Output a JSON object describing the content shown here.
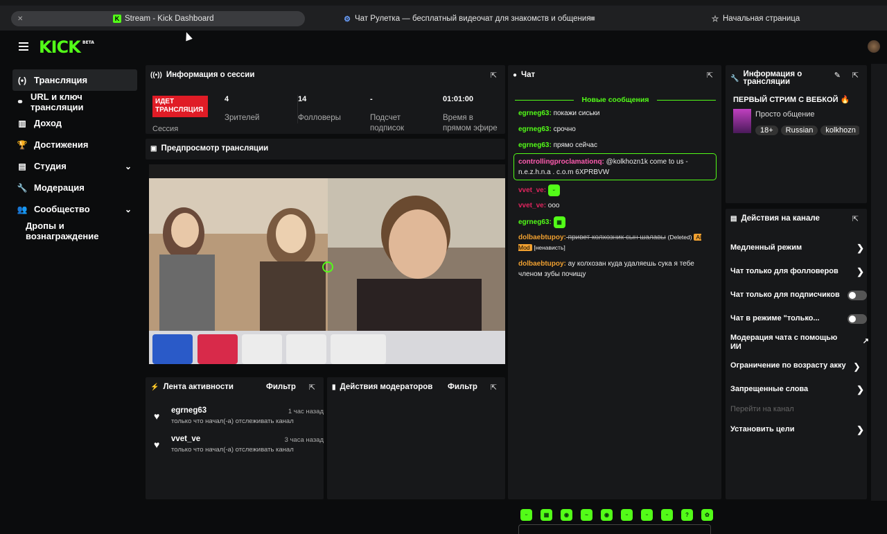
{
  "browser": {
    "tabs": [
      {
        "title": "Stream - Kick Dashboard",
        "active": true
      },
      {
        "title": "Чат Рулетка — бесплатный видеочат для знакомств и общения",
        "active": false
      },
      {
        "title": "Начальная страница",
        "active": false
      }
    ]
  },
  "header": {
    "logo": "KICK",
    "logo_badge": "BETA"
  },
  "sidebar": {
    "items": [
      {
        "label": "Трансляция",
        "icon": "broadcast-icon",
        "glyph": "(•)"
      },
      {
        "label": "URL и ключ трансляции",
        "icon": "link-icon",
        "glyph": "⚭"
      },
      {
        "label": "Доход",
        "icon": "chart-icon",
        "glyph": "▥"
      },
      {
        "label": "Достижения",
        "icon": "trophy-icon",
        "glyph": "🏆"
      },
      {
        "label": "Студия",
        "icon": "studio-icon",
        "glyph": "▤"
      },
      {
        "label": "Модерация",
        "icon": "wrench-icon",
        "glyph": "🔧"
      },
      {
        "label": "Сообщество",
        "icon": "community-icon",
        "glyph": "👥"
      },
      {
        "label": "Дропы и вознаграждение",
        "icon": "",
        "glyph": ""
      }
    ]
  },
  "session": {
    "title": "Информация о сессии",
    "badge": "ИДЕТ ТРАНСЛЯЦИЯ",
    "badge_label": "Сессия",
    "stats": [
      {
        "value": "4",
        "label": "Зрителей"
      },
      {
        "value": "14",
        "label": "Фолловеры"
      },
      {
        "value": "-",
        "label": "Подсчет подписок"
      },
      {
        "value": "01:01:00",
        "label": "Время в прямом эфире"
      }
    ]
  },
  "preview": {
    "title": "Предпросмотр трансляции"
  },
  "activity": {
    "title": "Лента активности",
    "filter": "Фильтр",
    "items": [
      {
        "name": "egrneg63",
        "time": "1 час назад",
        "desc": "только что начал(-а) отслеживать канал"
      },
      {
        "name": "vvet_ve",
        "time": "3 часа назад",
        "desc": "только что начал(-а) отслеживать канал"
      }
    ]
  },
  "modactions": {
    "title": "Действия модераторов",
    "filter": "Фильтр"
  },
  "chat": {
    "title": "Чат",
    "new_messages": "Новые сообщения",
    "messages": [
      {
        "user": "egrneg63:",
        "text": " покажи сиськи",
        "color": "#53fc18"
      },
      {
        "user": "egrneg63:",
        "text": " срочно",
        "color": "#53fc18"
      },
      {
        "user": "egrneg63:",
        "text": " прямо сейчас",
        "color": "#53fc18"
      },
      {
        "user": "controllingproclamationq:",
        "text": " @kolkhozn1k come to us - n.e.z.h.n.a . c.o.m 6XPRBVW",
        "color": "#ff5bb0"
      },
      {
        "user": "vvet_ve:",
        "text": "",
        "color": "#e0245e"
      },
      {
        "user": "vvet_ve:",
        "text": " ооо",
        "color": "#e0245e"
      },
      {
        "user": "egrneg63:",
        "text": "",
        "color": "#53fc18"
      },
      {
        "user": "dolbaebtupoy:",
        "text": " привет колхозник сын шалавы",
        "color": "#f0a030"
      },
      {
        "user": "dolbaebtupoy:",
        "text": " ау колхозан куда удаляешь сука я тебе членом зубы почищу",
        "color": "#f0a030"
      }
    ],
    "deleted_label": "(Deleted)",
    "ai_mod_label": "AI Mod",
    "hate_label": "[ненависть]"
  },
  "streaminfo": {
    "title": "Информация о трансляции",
    "stream_title": "ПЕРВЫЙ СТРИМ С ВЕБКОЙ 🔥",
    "category": "Просто общение",
    "tags": [
      "18+",
      "Russian",
      "kolkhozn"
    ]
  },
  "channel_actions": {
    "title": "Действия на канале",
    "rows": [
      {
        "label": "Медленный режим",
        "control": "chevron"
      },
      {
        "label": "Чат только для фолловеров",
        "control": "chevron"
      },
      {
        "label": "Чат только для подписчиков",
        "control": "toggle"
      },
      {
        "label": "Чат в режиме \"только...",
        "control": "toggle"
      },
      {
        "label": "Модерация чата с помощью ИИ",
        "control": "external"
      },
      {
        "label": "Ограничение по возрасту акку",
        "control": "chevron"
      },
      {
        "label": "Запрещенные слова",
        "control": "chevron"
      },
      {
        "label": "Перейти на канал",
        "control": "none"
      },
      {
        "label": "Установить цели",
        "control": "chevron"
      }
    ]
  }
}
